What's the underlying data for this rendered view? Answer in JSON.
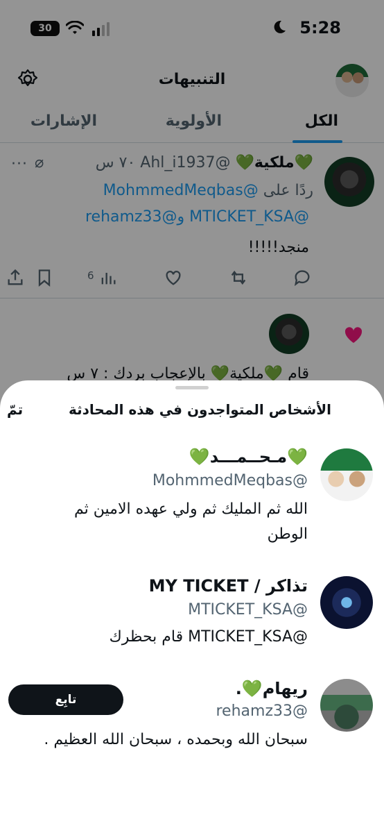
{
  "status_bar": {
    "time": "5:28",
    "battery": "30"
  },
  "header": {
    "title": "التنبيهات"
  },
  "tabs": [
    {
      "label": "الكل",
      "active": true
    },
    {
      "label": "الأولوية",
      "active": false
    },
    {
      "label": "الإشارات",
      "active": false
    }
  ],
  "tweet": {
    "name": "💚ملكية💚",
    "handle": "@Ahl_i1937",
    "time": "٧٠ س",
    "reply_prefix": "ردًا على",
    "reply_mention1": "@MohmmedMeqbas",
    "reply_mention2": "@MTICKET_KSA",
    "reply_and": "و",
    "reply_mention3": "@rehamz33",
    "body": "منجد!!!!!",
    "views": "6"
  },
  "like_notification": {
    "text": "قام 💚ملكية💚 بالإعجاب بردك : ٧ س"
  },
  "sheet": {
    "title": "الأشخاص المتواجدون في هذه المحادثة",
    "done_label": "تمّ",
    "people": [
      {
        "name": "💚مـحــمـــد💚",
        "handle": "@MohmmedMeqbas",
        "bio": "الله ثم المليك ثم ولي عهده الامين ثم الوطن"
      },
      {
        "name": "تذاكر / MY TICKET",
        "handle": "@MTICKET_KSA",
        "bio": "@MTICKET_KSA قام بحظرك"
      },
      {
        "name": "ريهام💚.",
        "handle": "@rehamz33",
        "bio": "سبحان الله وبحمده ، سبحان الله العظيم .",
        "follow_label": "تابِع"
      }
    ]
  },
  "colors": {
    "accent": "#1d9bf0",
    "like": "#f91880",
    "text": "#0f1419",
    "muted": "#536471"
  }
}
